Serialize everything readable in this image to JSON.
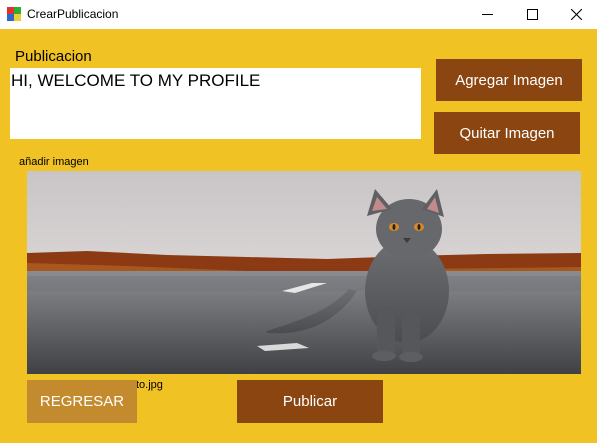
{
  "window": {
    "title": "CrearPublicacion"
  },
  "form": {
    "publicacion_label": "Publicacion",
    "post_text": "HI, WELCOME TO MY PROFILE",
    "add_image_label": "añadir imagen",
    "filename_fragment": "to.jpg"
  },
  "buttons": {
    "agregar": "Agregar Imagen",
    "quitar": "Quitar Imagen",
    "regresar": "REGRESAR",
    "publicar": "Publicar"
  },
  "colors": {
    "background": "#f0c224",
    "button": "#8b4510",
    "regresar_button": "#c48a2e"
  }
}
